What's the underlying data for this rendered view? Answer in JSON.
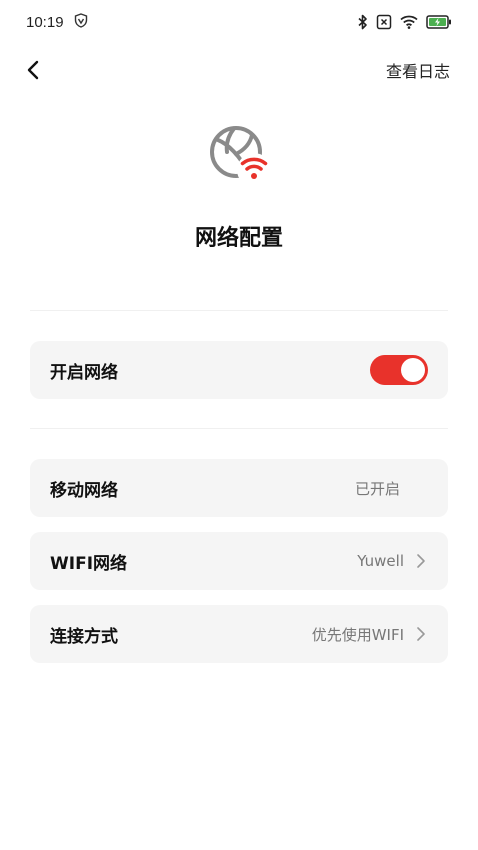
{
  "status_bar": {
    "time": "10:19",
    "icons": [
      "vpn-shield-icon",
      "bluetooth-icon",
      "sim-x-icon",
      "wifi-icon",
      "battery-charging-icon"
    ],
    "battery_color": "#4caf50"
  },
  "nav": {
    "back_icon": "chevron-left-icon",
    "log_link": "查看日志"
  },
  "header": {
    "icon": "globe-wifi-icon",
    "title": "网络配置",
    "accent_color": "#e8322b"
  },
  "settings": {
    "enable_network": {
      "label": "开启网络",
      "enabled": true
    },
    "mobile_network": {
      "label": "移动网络",
      "value": "已开启"
    },
    "wifi_network": {
      "label": "WIFI网络",
      "value": "Yuwell"
    },
    "connection_mode": {
      "label": "连接方式",
      "value": "优先使用WIFI"
    }
  }
}
